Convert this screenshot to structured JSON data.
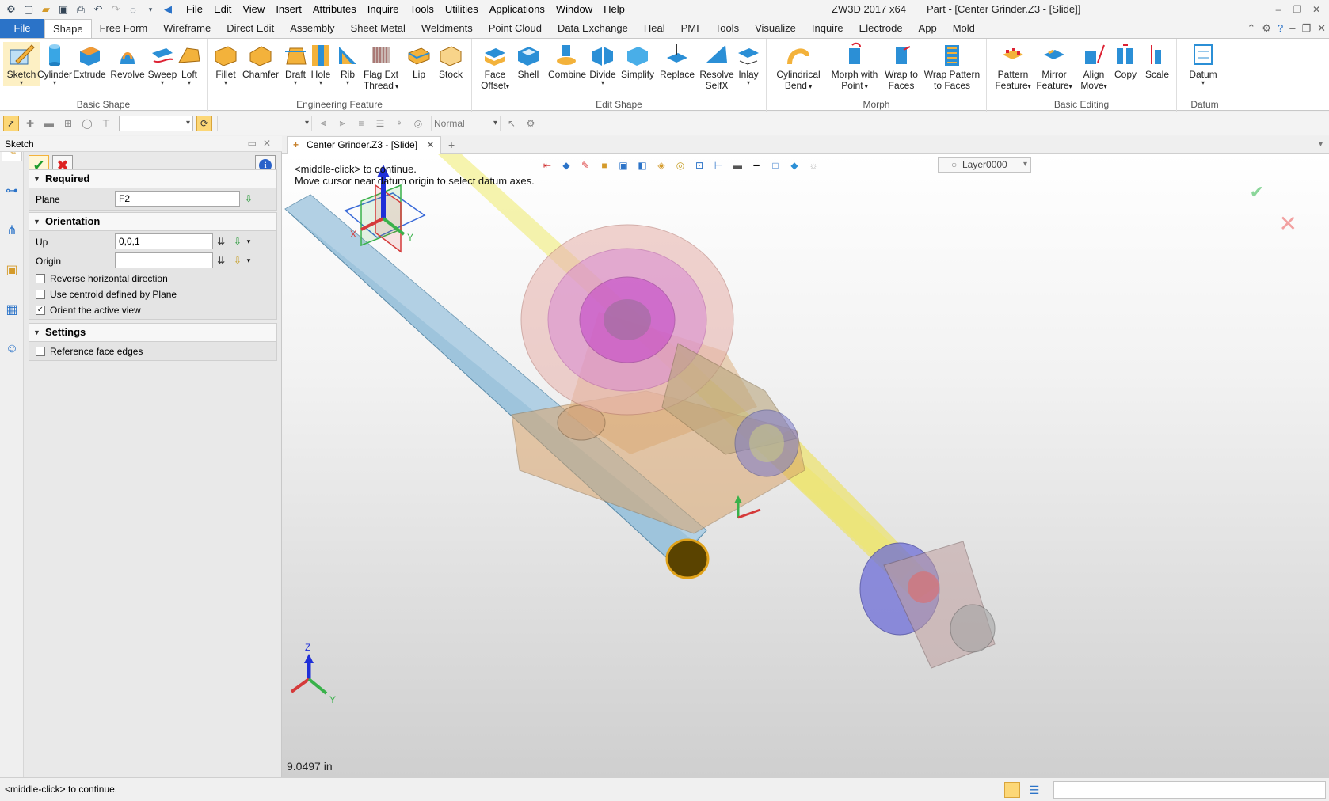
{
  "titlebar": {
    "app": "ZW3D 2017  x64",
    "document": "Part - [Center Grinder.Z3 - [Slide]]",
    "menus": [
      "File",
      "Edit",
      "View",
      "Insert",
      "Attributes",
      "Inquire",
      "Tools",
      "Utilities",
      "Applications",
      "Window",
      "Help"
    ]
  },
  "ribbon_tabs": [
    "Shape",
    "Free Form",
    "Wireframe",
    "Direct Edit",
    "Assembly",
    "Sheet Metal",
    "Weldments",
    "Point Cloud",
    "Data Exchange",
    "Heal",
    "PMI",
    "Tools",
    "Visualize",
    "Inquire",
    "Electrode",
    "App",
    "Mold"
  ],
  "file_tab": "File",
  "active_tab": "Shape",
  "groups": {
    "basic_shape": "Basic Shape",
    "engineering_feature": "Engineering Feature",
    "edit_shape": "Edit Shape",
    "morph": "Morph",
    "basic_editing": "Basic Editing",
    "datum": "Datum"
  },
  "tools": {
    "sketch": "Sketch",
    "cylinder": "Cylinder",
    "extrude": "Extrude",
    "revolve": "Revolve",
    "sweep": "Sweep",
    "loft": "Loft",
    "fillet": "Fillet",
    "chamfer": "Chamfer",
    "draft": "Draft",
    "hole": "Hole",
    "rib": "Rib",
    "flag_ext_1": "Flag Ext",
    "flag_ext_2": "Thread",
    "lip": "Lip",
    "stock": "Stock",
    "face_offset_1": "Face",
    "face_offset_2": "Offset",
    "shell": "Shell",
    "combine": "Combine",
    "divide": "Divide",
    "simplify": "Simplify",
    "replace": "Replace",
    "resolve_1": "Resolve",
    "resolve_2": "SelfX",
    "inlay": "Inlay",
    "cyl_bend_1": "Cylindrical",
    "cyl_bend_2": "Bend",
    "morph_pt_1": "Morph with",
    "morph_pt_2": "Point",
    "wrap_faces_1": "Wrap to",
    "wrap_faces_2": "Faces",
    "wrap_pattern_1": "Wrap Pattern",
    "wrap_pattern_2": "to Faces",
    "pattern_1": "Pattern",
    "pattern_2": "Feature",
    "mirror_1": "Mirror",
    "mirror_2": "Feature",
    "align_1": "Align",
    "align_2": "Move",
    "copy": "Copy",
    "scale": "Scale",
    "datum": "Datum"
  },
  "toolbar": {
    "render_mode": "Normal"
  },
  "panel": {
    "title": "Sketch",
    "required_header": "Required",
    "plane_label": "Plane",
    "plane_value": "F2",
    "orientation_header": "Orientation",
    "up_label": "Up",
    "up_value": "0,0,1",
    "origin_label": "Origin",
    "origin_value": "",
    "opt_reverse": "Reverse horizontal direction",
    "opt_centroid": "Use centroid defined by Plane",
    "opt_orient": "Orient the active view",
    "settings_header": "Settings",
    "opt_ref_edges": "Reference face edges"
  },
  "checkboxes": {
    "reverse": false,
    "centroid": false,
    "orient": true,
    "ref_edges": false
  },
  "doc_tab": "Center Grinder.Z3 - [Slide]",
  "viewport": {
    "layer": "Layer0000",
    "prompt_line1": "<middle-click> to continue.",
    "prompt_line2": "Move cursor near datum origin to select datum axes.",
    "measurement": "9.0497 in",
    "axis_x": "X",
    "axis_y": "Y",
    "axis_z": "Z"
  },
  "status": {
    "message": "<middle-click> to continue."
  },
  "colors": {
    "accent": "#2b73c8",
    "highlight": "#fcd777",
    "ok_green": "#1f9b2d",
    "cancel_red": "#dd2222"
  }
}
